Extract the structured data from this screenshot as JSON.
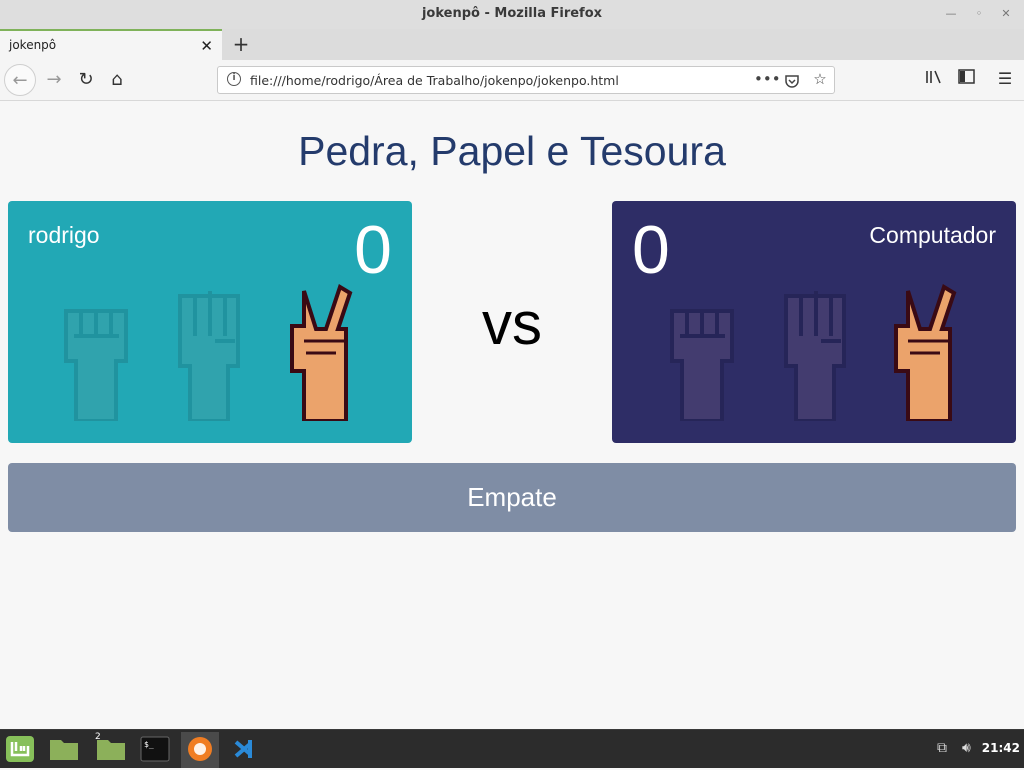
{
  "window": {
    "title": "jokenpô - Mozilla Firefox",
    "minimize_icon": "minimize-icon",
    "maximize_icon": "maximize-icon",
    "close_icon": "close-icon"
  },
  "tabs": [
    {
      "label": "jokenpô",
      "active": true
    }
  ],
  "navbar": {
    "url": "file:///home/rodrigo/Área de Trabalho/jokenpo/jokenpo.html"
  },
  "page": {
    "heading": "Pedra, Papel e Tesoura",
    "player": {
      "name": "rodrigo",
      "score": "0",
      "color": "#22a8b5",
      "hands": [
        "rock-icon",
        "paper-icon",
        "scissors-icon"
      ],
      "selected": "scissors"
    },
    "cpu": {
      "name": "Computador",
      "score": "0",
      "color": "#2e2d66",
      "hands": [
        "rock-icon",
        "paper-icon",
        "scissors-icon"
      ],
      "selected": "scissors"
    },
    "vs": "vs",
    "result": "Empate",
    "result_color": "#7f8da5"
  },
  "taskbar": {
    "clock": "21:42",
    "workspace_badge": "2",
    "items": [
      "mint-menu-icon",
      "files-icon",
      "files-icon",
      "terminal-icon",
      "firefox-icon",
      "vscode-icon"
    ]
  }
}
